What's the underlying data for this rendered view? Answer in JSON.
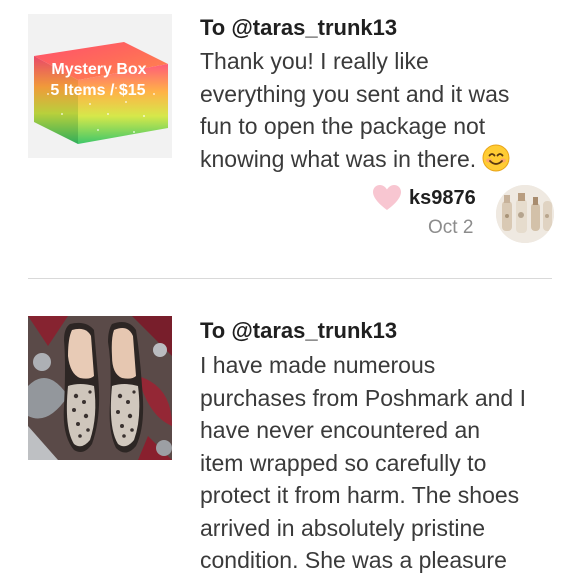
{
  "notes": [
    {
      "recipient": "To @taras_trunk13",
      "thumbnail": {
        "line1": "Mystery Box",
        "line2": "5 Items / $15"
      },
      "message_lines": [
        "Thank you! I really like",
        "everything you sent and it was",
        "fun to open the package not",
        "knowing what was in there."
      ],
      "emoji": "smiling-face-emoji",
      "author": "ks9876",
      "date": "Oct 2"
    },
    {
      "recipient": "To @taras_trunk13",
      "message_lines": [
        "I have made numerous",
        "purchases from Poshmark and I",
        "have never encountered an",
        "item wrapped so carefully to",
        "protect it from harm. The shoes",
        "arrived in absolutely pristine",
        "condition. She was a pleasure"
      ]
    }
  ],
  "colors": {
    "heart": "#f8c6d1",
    "divider": "#d9d9d9",
    "date": "#8c8c8c"
  }
}
